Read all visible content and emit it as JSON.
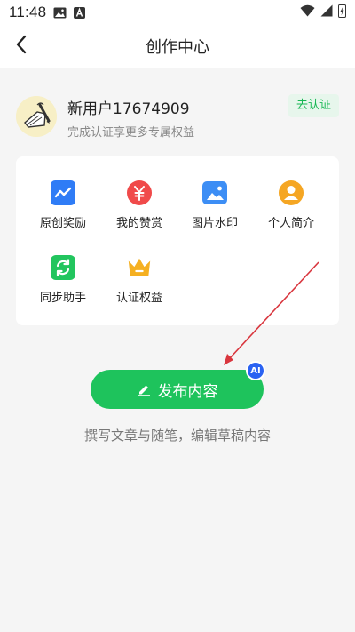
{
  "status_bar": {
    "time": "11:48",
    "icons": [
      "image-icon",
      "a-icon",
      "wifi-icon",
      "signal-icon",
      "battery-charging-icon"
    ]
  },
  "nav": {
    "title": "创作中心",
    "back_icon": "chevron-left-icon"
  },
  "profile": {
    "username": "新用户17674909",
    "subtitle": "完成认证享更多专属权益",
    "verify_label": "去认证"
  },
  "grid": {
    "items": [
      {
        "label": "原创奖励",
        "icon": "trend-chart-icon",
        "color": "#2f7cf6"
      },
      {
        "label": "我的赞赏",
        "icon": "yuan-icon",
        "color": "#f04a4a"
      },
      {
        "label": "图片水印",
        "icon": "image-icon",
        "color": "#3d8ef5"
      },
      {
        "label": "个人简介",
        "icon": "person-icon",
        "color": "#f5a623"
      },
      {
        "label": "同步助手",
        "icon": "sync-icon",
        "color": "#22c55e"
      },
      {
        "label": "认证权益",
        "icon": "crown-icon",
        "color": "#f5b021"
      }
    ]
  },
  "publish": {
    "label": "发布内容",
    "badge": "AI",
    "description": "撰写文章与随笔，编辑草稿内容"
  },
  "colors": {
    "accent": "#1ec35c",
    "badge": "#2a62f2",
    "annotation_arrow": "#d9363e"
  }
}
